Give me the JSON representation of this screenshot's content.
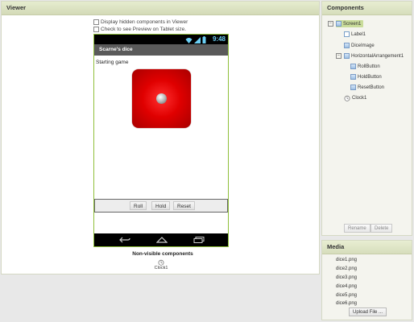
{
  "viewer": {
    "header": "Viewer",
    "display_hidden": "Display hidden components in Viewer",
    "tablet_preview": "Check to see Preview on Tablet size.",
    "phone": {
      "time": "9:48",
      "title": "Scarne's dice",
      "label1": "Starting game",
      "buttons": {
        "roll": "Roll",
        "hold": "Hold",
        "reset": "Reset"
      }
    },
    "non_visible_title": "Non-visible components",
    "clock_label": "Clock1"
  },
  "components": {
    "header": "Components",
    "tree": {
      "screen": "Screen1",
      "label1": "Label1",
      "dice_image": "DiceImage",
      "harr": "HorizontalArrangement1",
      "roll_button": "RollButton",
      "hold_button": "HoldButton",
      "reset_button": "ResetButton",
      "clock": "Clock1"
    },
    "rename": "Rename",
    "delete": "Delete"
  },
  "media": {
    "header": "Media",
    "files": [
      "dice1.png",
      "dice2.png",
      "dice3.png",
      "dice4.png",
      "dice5.png",
      "dice6.png"
    ],
    "upload": "Upload File ..."
  }
}
